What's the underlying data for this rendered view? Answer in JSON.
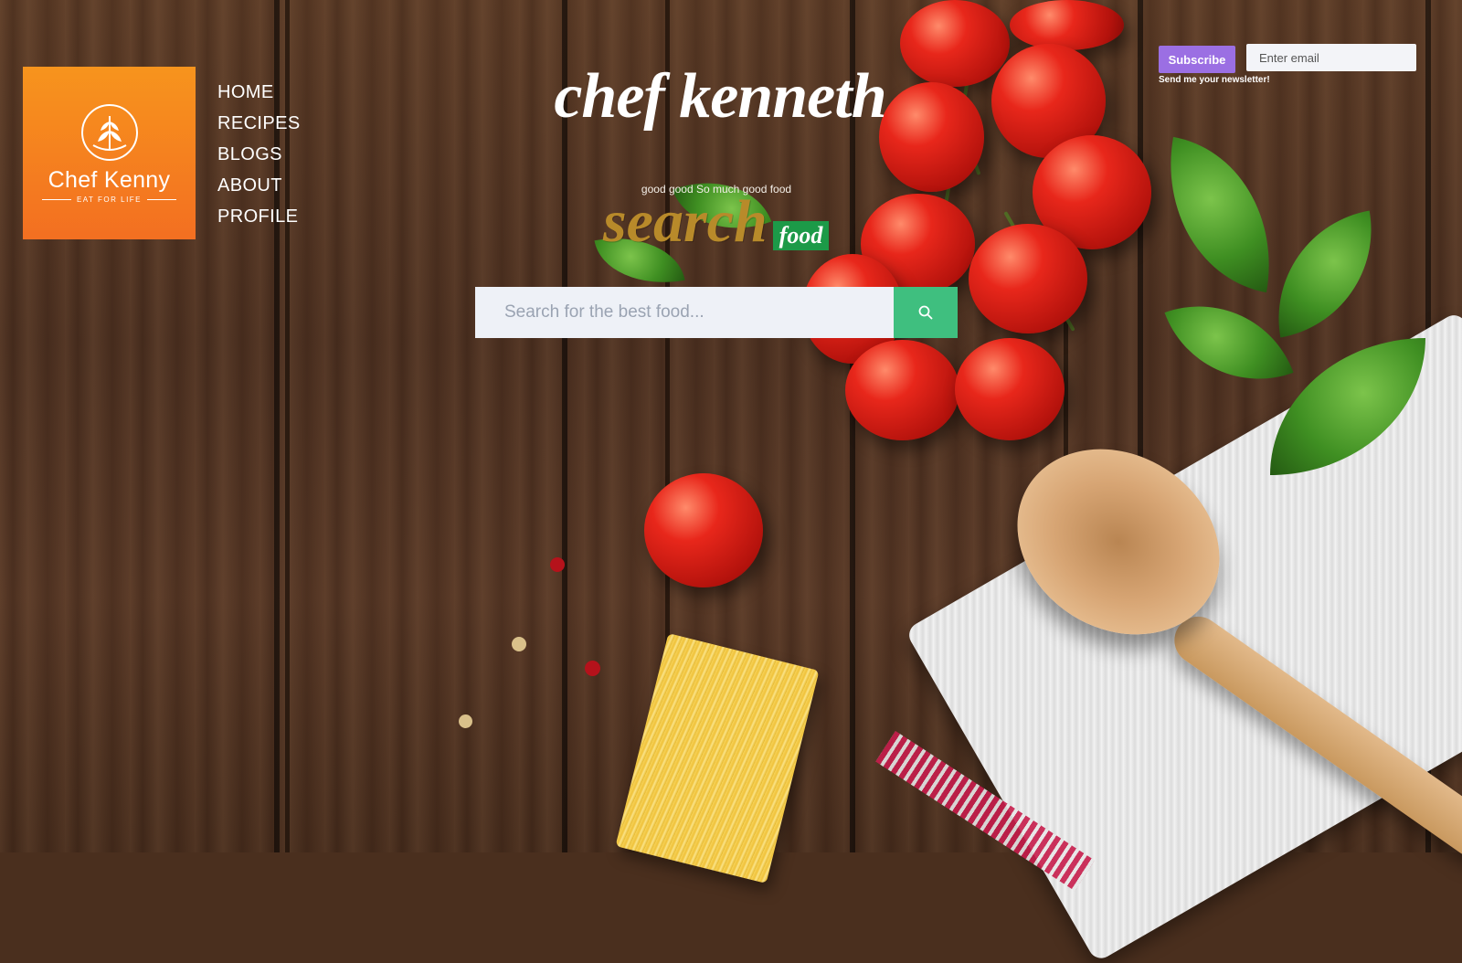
{
  "brand": {
    "logo_name": "Chef Kenny",
    "logo_tagline": "EAT FOR LIFE",
    "logo_color": "#f36f21",
    "emblem_icon": "wheat-emblem-icon"
  },
  "nav": {
    "items": [
      {
        "label": "HOME"
      },
      {
        "label": "RECIPES"
      },
      {
        "label": "BLOGS"
      },
      {
        "label": "ABOUT"
      },
      {
        "label": "PROFILE"
      }
    ]
  },
  "hero": {
    "title": "chef kenneth",
    "tagline": "good good So much good food",
    "search_word": "search",
    "food_badge": "food",
    "badge_color": "#1c9a48"
  },
  "search": {
    "placeholder": "Search for the best food...",
    "value": "",
    "button_icon": "search-icon",
    "button_color": "#3fbf7f"
  },
  "newsletter": {
    "subscribe_label": "Subscribe",
    "email_placeholder": "Enter email",
    "note": "Send me your newsletter!",
    "button_color": "#9b6fe3"
  }
}
